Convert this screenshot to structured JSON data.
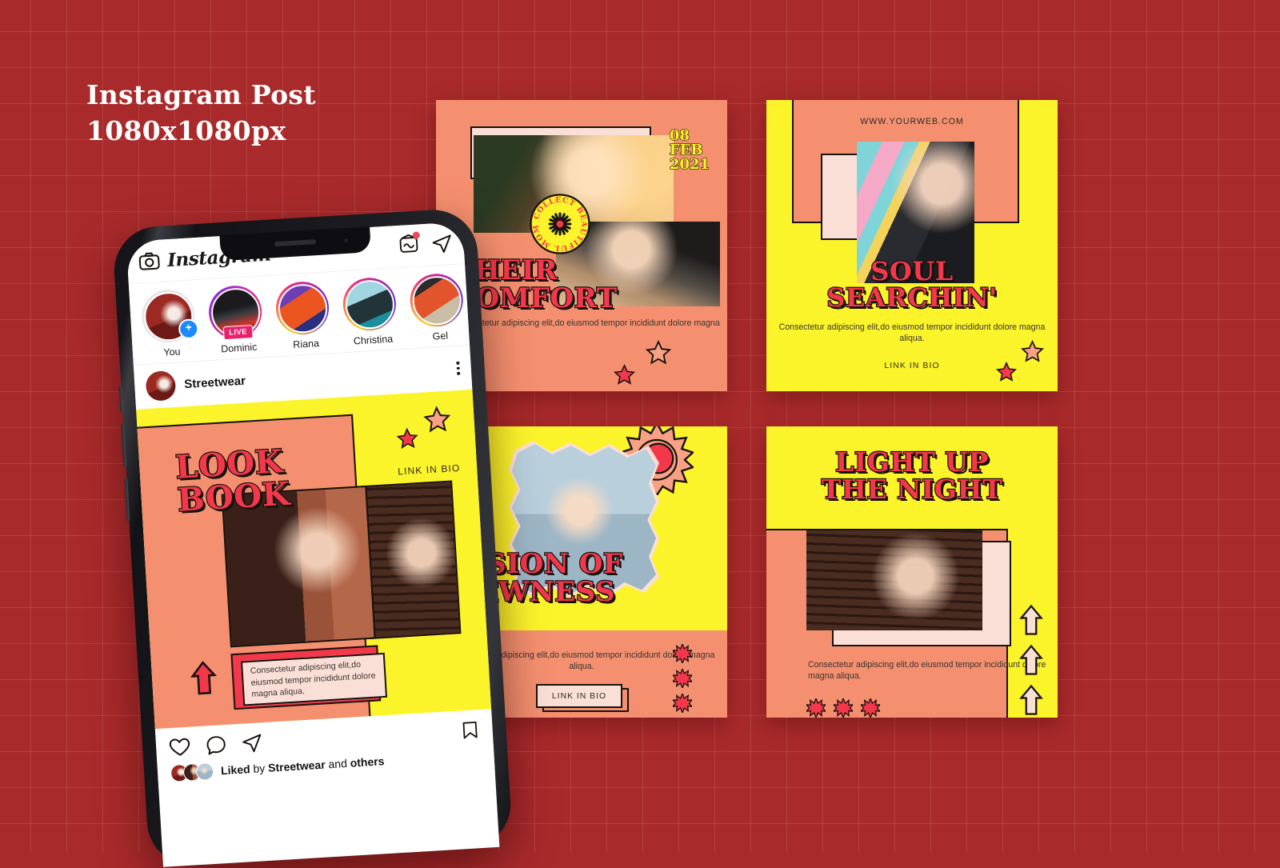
{
  "heading": {
    "line1": "Instagram Post",
    "line2": "1080x1080px"
  },
  "colors": {
    "background_red": "#a92a2b",
    "accent_red": "#f4384c",
    "yellow": "#fcf42a",
    "salmon": "#f4906f",
    "pale_pink": "#fadfd6",
    "outline": "#17120f"
  },
  "phone": {
    "app_name": "Instagram",
    "header_icons": {
      "camera": "camera-icon",
      "igtv": "igtv-icon",
      "messenger": "paper-plane-icon"
    },
    "stories": [
      {
        "name": "You",
        "badge": "+",
        "live": false
      },
      {
        "name": "Dominic",
        "badge": "LIVE",
        "live": true
      },
      {
        "name": "Riana",
        "badge": "",
        "live": false
      },
      {
        "name": "Christina",
        "badge": "",
        "live": false
      },
      {
        "name": "Gel",
        "badge": "",
        "live": false
      }
    ],
    "post": {
      "username": "Streetwear",
      "more_icon": "more-options-icon",
      "actions": {
        "like": "heart-icon",
        "comment": "comment-icon",
        "share": "paper-plane-icon",
        "save": "bookmark-icon"
      },
      "liked_by_prefix": "Liked",
      "liked_by_mid": " by ",
      "liked_by_user": "Streetwear",
      "liked_by_suffix": " and ",
      "liked_by_others": "others"
    }
  },
  "posts": {
    "lookbook": {
      "title_line1": "LOOK",
      "title_line2": "BOOK",
      "link_in_bio": "LINK IN BIO",
      "caption": "Consectetur adipiscing elit,do eiusmod tempor incididunt dolore magna aliqua."
    },
    "comfort": {
      "title_line1": "THEIR",
      "title_line2": "COMFORT",
      "date_day": "08",
      "date_month": "FEB",
      "date_year": "2021",
      "badge_text": "COLLECT BEAUTIFUL MOMENT",
      "caption": "Consectetur adipiscing elit,do eiusmod tempor incididunt dolore magna aliqua."
    },
    "soul": {
      "website": "WWW.YOURWEB.COM",
      "title_line1": "SOUL",
      "title_line2": "SEARCHIN'",
      "caption": "Consectetur adipiscing elit,do eiusmod tempor incididunt dolore magna aliqua.",
      "link_in_bio": "LINK IN BIO"
    },
    "vision": {
      "title_line1": "VISION OF",
      "title_line2": "NEWNESS",
      "caption": "Consectetur adipiscing elit,do eiusmod tempor incididunt dolore magna aliqua.",
      "button_label": "LINK IN BIO"
    },
    "night": {
      "title_line1": "LIGHT UP",
      "title_line2": "THE NIGHT",
      "caption": "Consectetur adipiscing elit,do eiusmod tempor incididunt dolore magna aliqua."
    }
  }
}
